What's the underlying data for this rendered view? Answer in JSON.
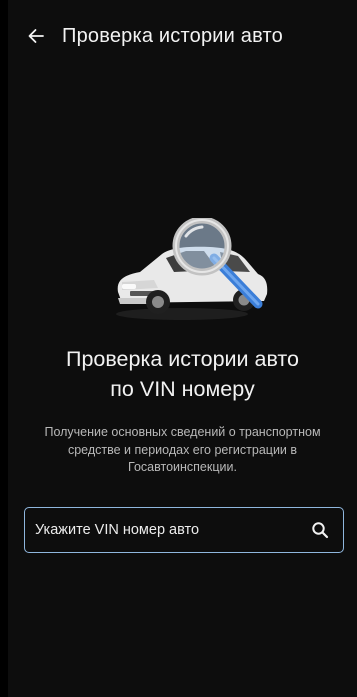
{
  "app_bar": {
    "title": "Проверка истории авто",
    "back_icon": "arrow-left-icon"
  },
  "hero": {
    "illustration_icon": "car-magnifier-icon",
    "headline_line1": "Проверка истории авто",
    "headline_line2": "по VIN номеру",
    "description_line1": "Получение основных сведений о транспортном",
    "description_line2": "средстве и периодах его регистрации в",
    "description_line3": "Госавтоинспекции."
  },
  "search": {
    "placeholder": "Укажите VIN номер авто",
    "value": "",
    "icon": "search-icon"
  },
  "colors": {
    "background": "#0d0d0d",
    "text_primary": "#f2f2f2",
    "text_secondary": "#b8b8b8",
    "input_border": "#8fb6dd",
    "magnifier_handle": "#3b7ed8"
  }
}
